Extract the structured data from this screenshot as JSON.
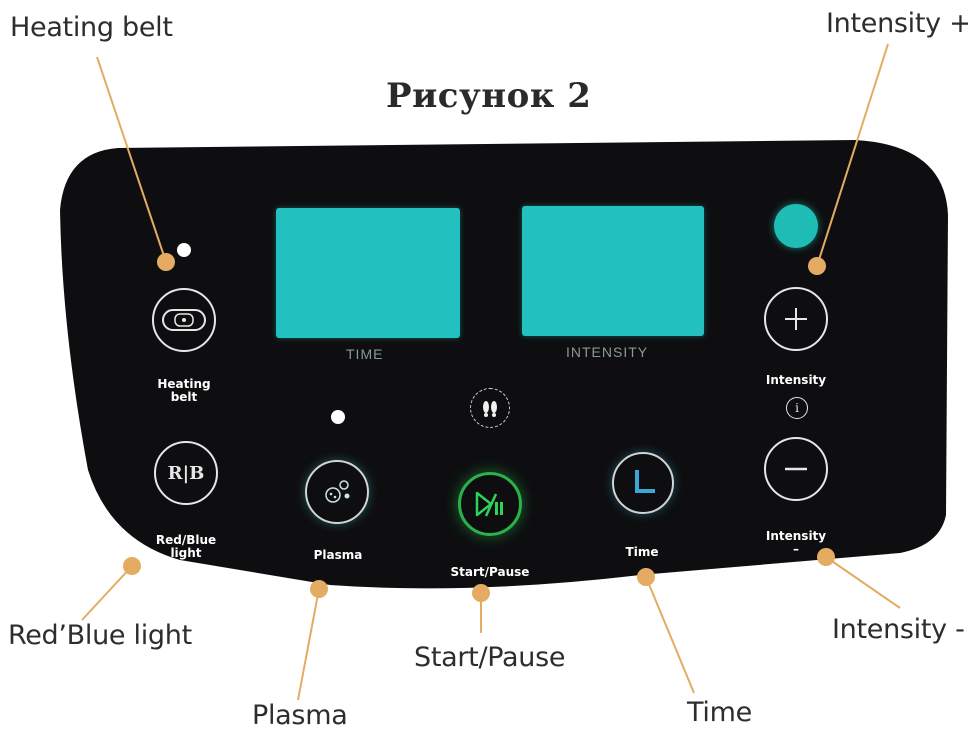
{
  "title": "Рисунок 2",
  "callouts": {
    "heating_belt": "Heating belt",
    "intensity_plus": "Intensity +",
    "red_blue_light": "Red’Blue light",
    "intensity_minus": "Intensity -",
    "start_pause": "Start/Pause",
    "plasma": "Plasma",
    "time": "Time"
  },
  "panel": {
    "time_label": "TIME",
    "intensity_label": "INTENSITY",
    "buttons": {
      "heating_belt": "Heating\nbelt",
      "red_blue": "Red/Blue\nlight",
      "red_blue_icon": "R|B",
      "plasma": "Plasma",
      "start_pause": "Start/Pause",
      "time": "Time",
      "intensity_top": "Intensity",
      "intensity_info_icon": "i",
      "intensity_bottom": "Intensity\n–"
    }
  },
  "colors": {
    "panel": "#0e0e10",
    "screen": "#22c1c0",
    "leader": "#e3ac62",
    "start_button": "#29b34a"
  },
  "icons": [
    "heating-belt-icon",
    "red-blue-icon",
    "plasma-icon",
    "start-pause-icon",
    "clock-icon",
    "plus-icon",
    "minus-icon",
    "info-icon",
    "footprints-icon"
  ]
}
